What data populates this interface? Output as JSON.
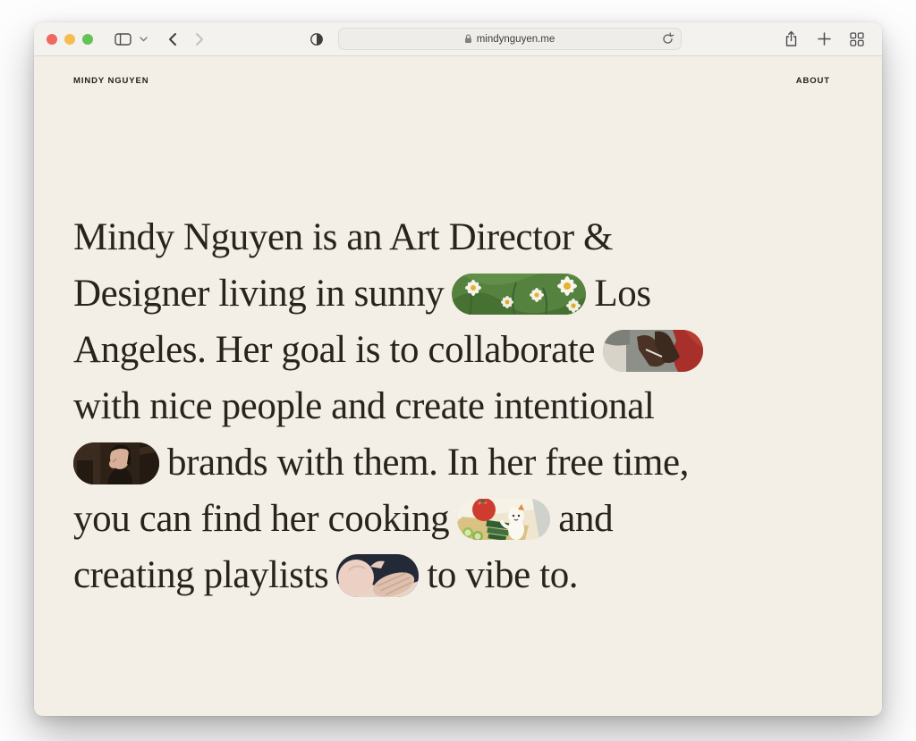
{
  "browser": {
    "url": "mindynguyen.me",
    "traffic_lights": [
      {
        "name": "close",
        "color": "#ee6a5f"
      },
      {
        "name": "minimize",
        "color": "#f5bd4f"
      },
      {
        "name": "zoom",
        "color": "#61c455"
      }
    ],
    "toolbar_icons": [
      "sidebar-icon",
      "chevron-down-icon",
      "back-icon",
      "forward-icon",
      "privacy-shield-icon",
      "lock-icon",
      "reload-icon",
      "share-icon",
      "new-tab-icon",
      "tab-overview-icon"
    ]
  },
  "site": {
    "logo": "MINDY NGUYEN",
    "nav": [
      {
        "label": "ABOUT"
      }
    ]
  },
  "hero": {
    "full_text": "Mindy Nguyen is an Art Director & Designer living in sunny Los Angeles. Her goal is to collaborate with nice people and create intentional brands with them. In her free time, you can find her cooking and creating playlists to vibe to.",
    "inline_images": [
      {
        "name": "daisies-photo",
        "description": "white daisies in green grass"
      },
      {
        "name": "arm-wrestle-photo",
        "description": "two arms clasped, person in red shirt"
      },
      {
        "name": "chef-kiss-photo",
        "description": "man making chef's kiss gesture"
      },
      {
        "name": "cooking-illustration",
        "description": "cartoon cat cooking with tomato and cucumber"
      },
      {
        "name": "hands-photo",
        "description": "pale hands on dark background"
      }
    ],
    "lines": [
      {
        "segments": [
          {
            "value": "Mindy Nguyen is an Art Director &"
          }
        ]
      },
      {
        "segments": [
          {
            "value": "Designer living in sunny"
          },
          {
            "value": "Los"
          }
        ]
      },
      {
        "segments": [
          {
            "value": "Angeles. Her goal is to collaborate"
          }
        ]
      },
      {
        "segments": [
          {
            "value": "with nice people and create intentional"
          }
        ]
      },
      {
        "segments": [
          {
            "value": "brands with them. In her free time,"
          }
        ]
      },
      {
        "segments": [
          {
            "value": "you can find her cooking"
          },
          {
            "value": "and"
          }
        ]
      },
      {
        "segments": [
          {
            "value": "creating playlists"
          },
          {
            "value": "to vibe to."
          }
        ]
      }
    ]
  },
  "colors": {
    "page_bg": "#f4efe6",
    "toolbar_bg": "#f4f2ef",
    "hero_text": "#27241e",
    "header_text": "#211f1b"
  }
}
